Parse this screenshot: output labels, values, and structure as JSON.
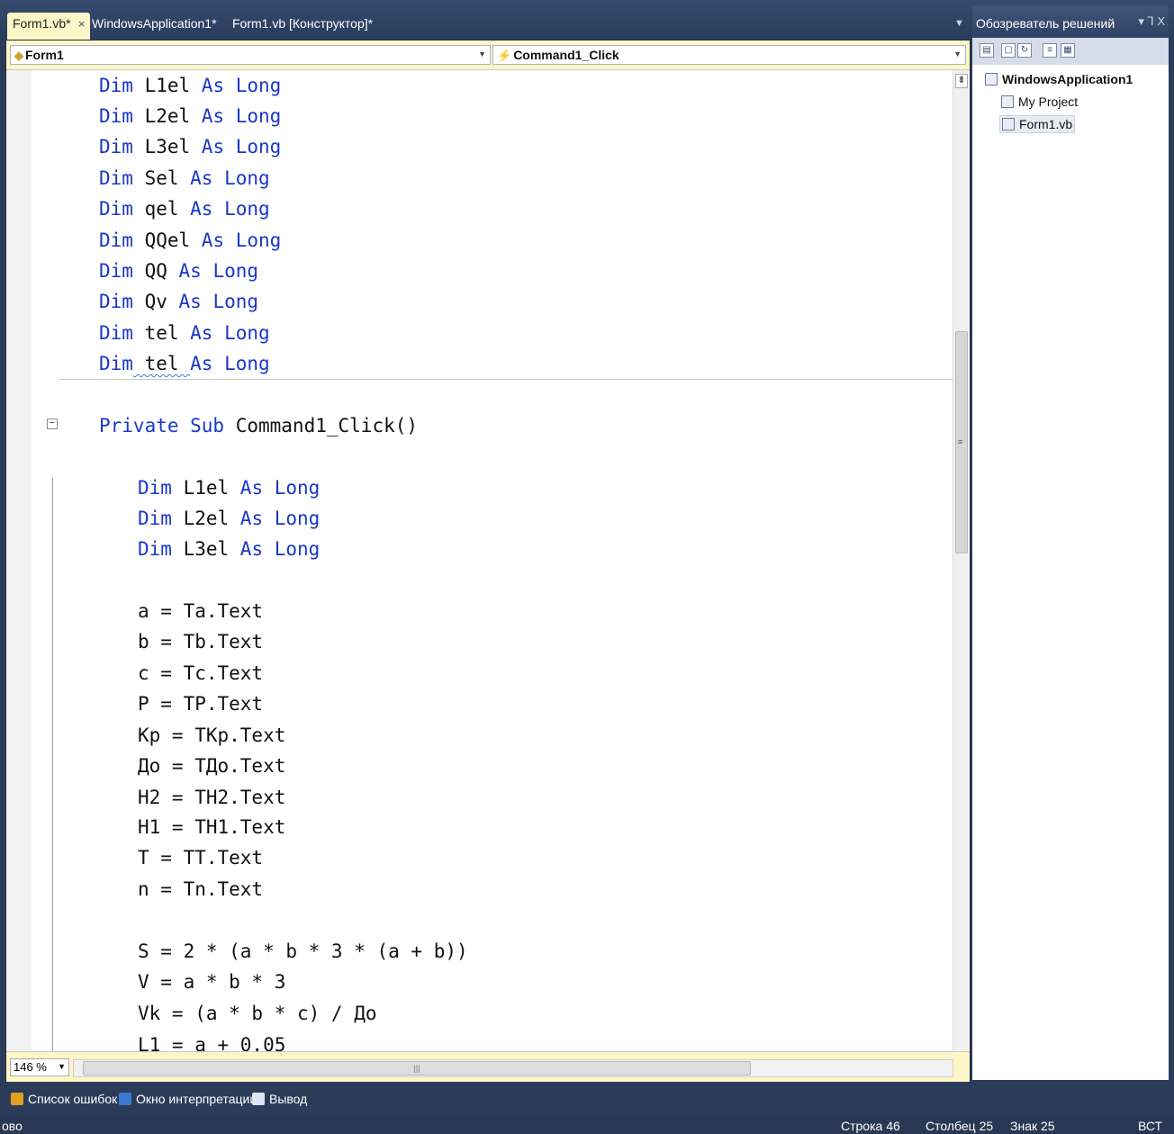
{
  "tabs": [
    {
      "label": "Form1.vb*",
      "close": "×",
      "active": true
    },
    {
      "label": "WindowsApplication1*",
      "active": false
    },
    {
      "label": "Form1.vb [Конструктор]*",
      "active": false
    }
  ],
  "navbar": {
    "class_combo": "Form1",
    "method_combo": "Command1_Click"
  },
  "code_lines": [
    {
      "kw1": "Dim",
      "text": " L1el ",
      "kw2": "As Long"
    },
    {
      "kw1": "Dim",
      "text": " L2el ",
      "kw2": "As Long"
    },
    {
      "kw1": "Dim",
      "text": " L3el ",
      "kw2": "As Long"
    },
    {
      "kw1": "Dim",
      "text": " Sel ",
      "kw2": "As Long"
    },
    {
      "kw1": "Dim",
      "text": " qel ",
      "kw2": "As Long"
    },
    {
      "kw1": "Dim",
      "text": " QQel ",
      "kw2": "As Long"
    },
    {
      "kw1": "Dim",
      "text": " QQ ",
      "kw2": "As Long"
    },
    {
      "kw1": "Dim",
      "text": " Qv ",
      "kw2": "As Long"
    },
    {
      "kw1": "Dim",
      "text": " tel ",
      "kw2": "As Long"
    },
    {
      "kw1": "Dim",
      "text": " tel ",
      "kw2": "As Long"
    },
    {
      "kw1": "Private Sub",
      "text": " Command1_Click()",
      "kw2": ""
    },
    {
      "kw1": "Dim",
      "text": " L1el ",
      "kw2": "As Long"
    },
    {
      "kw1": "Dim",
      "text": " L2el ",
      "kw2": "As Long"
    },
    {
      "kw1": "Dim",
      "text": " L3el ",
      "kw2": "As Long"
    },
    {
      "text": "a = Ta.Text"
    },
    {
      "text": "b = Tb.Text"
    },
    {
      "text": "c = Tc.Text"
    },
    {
      "text": "P = TP.Text"
    },
    {
      "text": "Kp = TKp.Text"
    },
    {
      "text": "До = TДо.Text"
    },
    {
      "text": "H2 = TH2.Text"
    },
    {
      "text": "H1 = TH1.Text"
    },
    {
      "text": "T = TT.Text"
    },
    {
      "text": "n = Tn.Text"
    },
    {
      "text": "S = 2 * (a * b * 3 * (a + b))"
    },
    {
      "text": "V = a * b * 3"
    },
    {
      "text": "Vk = (a * b * c) / До"
    },
    {
      "text": "L1 = a + 0.05"
    }
  ],
  "zoom": "146 %",
  "solution_explorer": {
    "title": "Обозреватель решений",
    "controls": "▾ ⅂ X",
    "items": [
      {
        "label": "WindowsApplication1"
      },
      {
        "label": "My Project"
      },
      {
        "label": "Form1.vb"
      }
    ]
  },
  "tool_tabs": [
    {
      "label": "Список ошибок",
      "color": "#e0a020"
    },
    {
      "label": "Окно интерпретации",
      "color": "#3c7ad0"
    },
    {
      "label": "Вывод",
      "color": "#dfe6f2"
    }
  ],
  "status": {
    "left": "ово",
    "line": "Строка 46",
    "col": "Столбец 25",
    "char": "Знак 25",
    "mode": "ВСТ"
  }
}
